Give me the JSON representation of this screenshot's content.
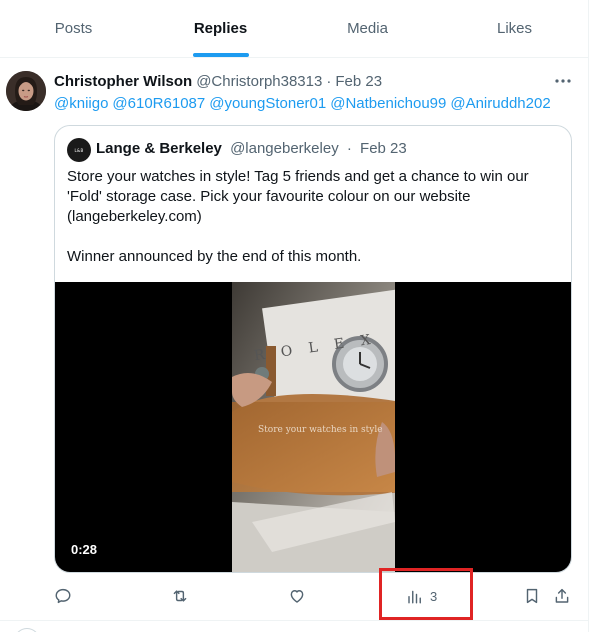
{
  "tabs": [
    {
      "label": "Posts",
      "active": false
    },
    {
      "label": "Replies",
      "active": true
    },
    {
      "label": "Media",
      "active": false
    },
    {
      "label": "Likes",
      "active": false
    }
  ],
  "tweet": {
    "author_name": "Christopher Wilson",
    "handle": "@Christorph38313",
    "separator": "·",
    "date": "Feb 23",
    "mentions": [
      "@kniigo",
      "@610R61087",
      "@youngStoner01",
      "@Natbenichou99",
      "@Aniruddh202"
    ]
  },
  "quote": {
    "author_name": "Lange & Berkeley",
    "handle": "@langeberkeley",
    "separator": "·",
    "date": "Feb 23",
    "text": "Store your watches in style! Tag 5 friends and get a chance to win our 'Fold' storage case. Pick your favourite colour on our website (langeberkeley.com)\n\nWinner announced by the end of this month.",
    "video": {
      "duration": "0:28",
      "overlay_text": "Store your watches in style",
      "brand_text": "ROLEX"
    }
  },
  "actions": {
    "views_count": "3"
  },
  "colors": {
    "accent": "#1d9bf0",
    "text_secondary": "#536471",
    "highlight": "#e02424"
  },
  "icons": [
    "more-icon",
    "reply-icon",
    "repost-icon",
    "like-icon",
    "views-icon",
    "bookmark-icon",
    "share-icon"
  ]
}
